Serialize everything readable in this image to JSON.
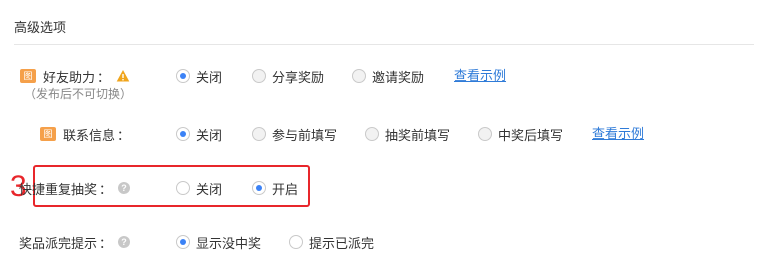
{
  "section": {
    "title": "高级选项"
  },
  "friend_help": {
    "badge": "图",
    "label": "好友助力",
    "colon": "：",
    "sublabel": "（发布后不可切换）",
    "options": [
      "关闭",
      "分享奖励",
      "邀请奖励"
    ],
    "selected": 0,
    "link": "查看示例"
  },
  "contact_info": {
    "badge": "图",
    "label": "联系信息",
    "colon": "：",
    "options": [
      "关闭",
      "参与前填写",
      "抽奖前填写",
      "中奖后填写"
    ],
    "selected": 0,
    "link": "查看示例"
  },
  "quick_redraw": {
    "label": "快捷重复抽奖",
    "colon": "：",
    "help": "?",
    "options": [
      "关闭",
      "开启"
    ],
    "selected": 1
  },
  "prize_out_notice": {
    "label": "奖品派完提示",
    "colon": "：",
    "help": "?",
    "options": [
      "显示没中奖",
      "提示已派完"
    ],
    "selected": 0
  },
  "annotation": {
    "number": "3"
  },
  "colors": {
    "accent": "#3b82f6",
    "badge": "#f5a04a",
    "annotation": "#e8262b",
    "link": "#2f7bd8"
  }
}
